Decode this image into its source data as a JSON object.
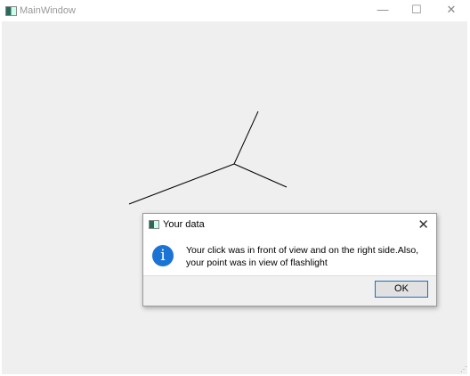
{
  "window": {
    "title": "MainWindow",
    "minimize": "—",
    "maximize": "☐",
    "close": "✕"
  },
  "dialog": {
    "title": "Your data",
    "close": "✕",
    "icon": "info-icon",
    "icon_glyph": "i",
    "message": "Your click was in front of view and on the right side.Also, your point was in view of flashlight",
    "ok_label": "OK"
  },
  "colors": {
    "info": "#1b74d4",
    "client_bg": "#efefef"
  }
}
